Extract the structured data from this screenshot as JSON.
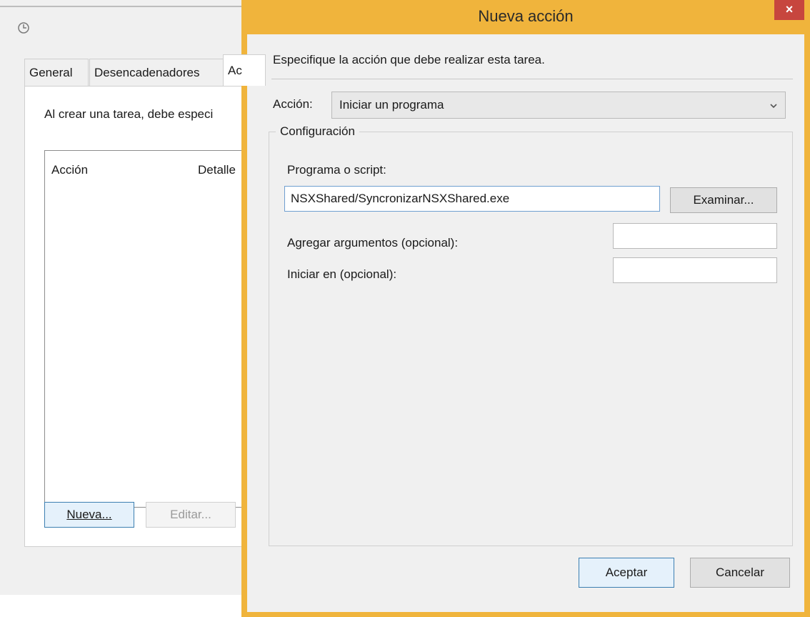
{
  "background_window": {
    "tabs": [
      "General",
      "Desencadenadores",
      "Ac"
    ],
    "description": "Al crear una tarea, debe especi",
    "columns": [
      "Acción",
      "Detalle"
    ],
    "buttons": {
      "new": "Nueva...",
      "edit": "Editar..."
    }
  },
  "dialog": {
    "title": "Nueva acción",
    "close": "×",
    "instruction": "Especifique la acción que debe realizar esta tarea.",
    "action_label": "Acción:",
    "action_value": "Iniciar un programa",
    "config_title": "Configuración",
    "program_label": "Programa o script:",
    "program_value": "NSXShared/SyncronizarNSXShared.exe",
    "browse_label": "Examinar...",
    "args_label": "Agregar argumentos (opcional):",
    "start_label": "Iniciar en (opcional):",
    "accept_label": "Aceptar",
    "cancel_label": "Cancelar"
  },
  "colors": {
    "dialog_frame": "#f0b43c",
    "close_button": "#c7463e",
    "focus_border": "#3c7fb1"
  }
}
